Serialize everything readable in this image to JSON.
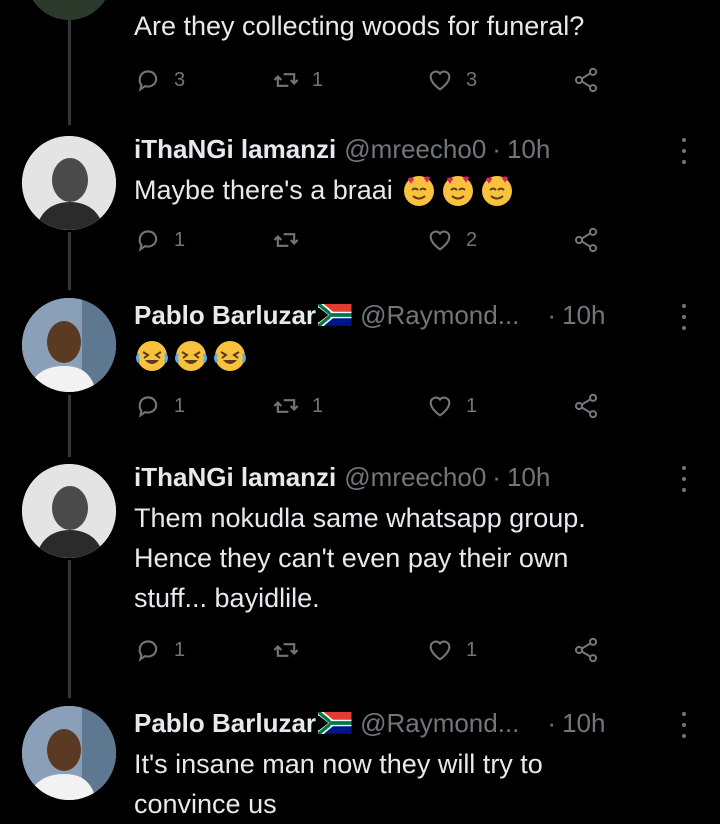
{
  "top_tweet": {
    "text": "Are they collecting woods for funeral?",
    "replies": "3",
    "retweets": "1",
    "likes": "3"
  },
  "tweets": [
    {
      "name": "iThaNGi lamanzi",
      "handle": "@mreecho0",
      "dot": "·",
      "time": "10h",
      "text": "Maybe there's a braai",
      "emoji": [
        "smiling-face-with-hearts",
        "smiling-face-with-hearts",
        "smiling-face-with-hearts"
      ],
      "replies": "1",
      "retweets": "",
      "likes": "2"
    },
    {
      "name": "Pablo Barluzar",
      "handle": "@Raymond...",
      "dot": "·",
      "time": "10h",
      "text": "",
      "emoji": [
        "rolling-on-floor-laughing",
        "rolling-on-floor-laughing",
        "rolling-on-floor-laughing"
      ],
      "replies": "1",
      "retweets": "1",
      "likes": "1"
    },
    {
      "name": "iThaNGi lamanzi",
      "handle": "@mreecho0",
      "dot": "·",
      "time": "10h",
      "text": "Them nokudla same whatsapp group.\nHence they can't even pay their own\nstuff... bayidlile.",
      "replies": "1",
      "retweets": "",
      "likes": "1"
    },
    {
      "name": "Pablo Barluzar",
      "handle": "@Raymond...",
      "dot": "·",
      "time": "10h",
      "text": "It's insane man now they will try to\nconvince us"
    }
  ],
  "colors": {
    "background": "#000000",
    "text": "#e7e9ea",
    "muted": "#71767b",
    "thread_line": "#333639"
  },
  "icons": [
    "reply-icon",
    "retweet-icon",
    "like-icon",
    "share-icon",
    "more-icon",
    "south-africa-flag-icon"
  ]
}
